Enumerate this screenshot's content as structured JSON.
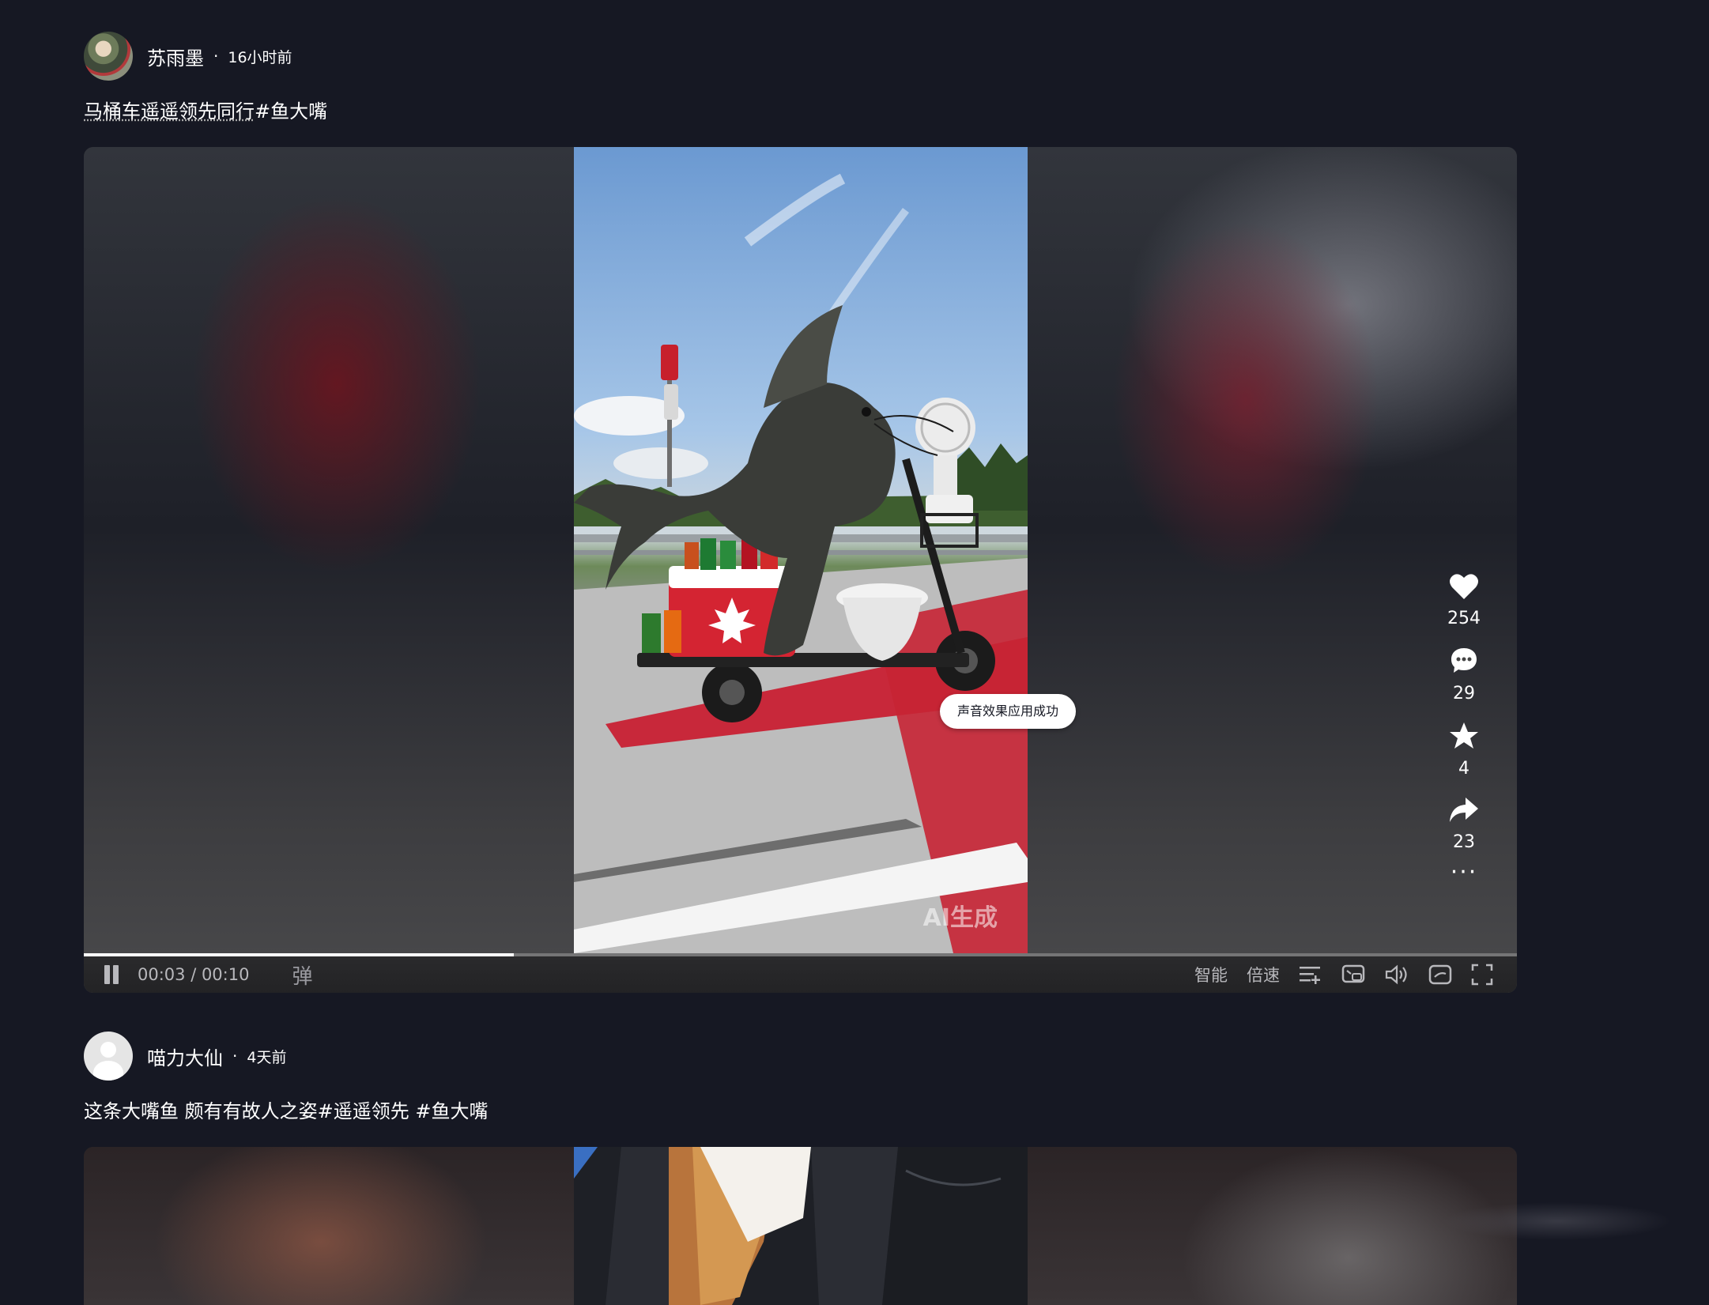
{
  "posts": [
    {
      "author": "苏雨墨",
      "separator": "·",
      "time": "16小时前",
      "title_plain": "马桶车遥遥领先同行",
      "title_tag": "#鱼大嘴",
      "video": {
        "watermark": "AI生成",
        "toast": "声音效果应用成功",
        "current_time": "00:03",
        "duration": "00:10",
        "time_label": "00:03 / 00:10",
        "progress": 0.3,
        "danmu_label": "弹",
        "controls": {
          "smart_label": "智能",
          "speed_label": "倍速"
        }
      },
      "actions": {
        "likes": "254",
        "comments": "29",
        "favorites": "4",
        "shares": "23",
        "more": "···"
      }
    },
    {
      "author": "喵力大仙",
      "separator": "·",
      "time": "4天前",
      "title": "这条大嘴鱼 颇有有故人之姿#遥遥领先 #鱼大嘴"
    }
  ],
  "colors": {
    "background": "#161823",
    "text": "#ffffff",
    "controls_text": "#b8b8bc",
    "toast_bg": "#ffffff"
  },
  "icons": [
    "heart-icon",
    "comment-icon",
    "star-icon",
    "share-icon",
    "more-icon",
    "pause-icon",
    "playlist-icon",
    "pip-icon",
    "volume-icon",
    "mini-player-icon",
    "fullscreen-icon"
  ]
}
